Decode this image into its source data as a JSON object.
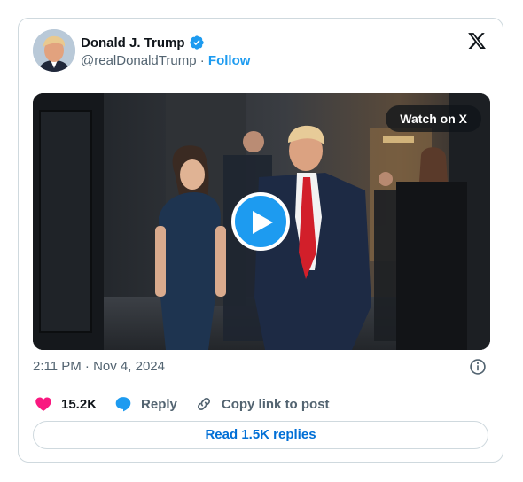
{
  "post": {
    "author": {
      "display_name": "Donald J. Trump",
      "handle": "@realDonaldTrump",
      "verified": true,
      "avatar_icon": "profile-photo"
    },
    "separator": "·",
    "follow_label": "Follow",
    "platform_icon": "x-logo-icon",
    "media": {
      "type": "video",
      "watch_label": "Watch on X",
      "play_icon": "play-icon"
    },
    "timestamp": "2:11 PM · Nov 4, 2024",
    "info_icon": "info-icon",
    "actions": {
      "like_count": "15.2K",
      "reply_label": "Reply",
      "copy_label": "Copy link to post"
    },
    "read_replies_label": "Read 1.5K replies"
  },
  "colors": {
    "accent": "#1d9bf0",
    "link": "#006fd6",
    "like": "#f91880",
    "muted": "#536471",
    "border": "#cfd9de"
  }
}
